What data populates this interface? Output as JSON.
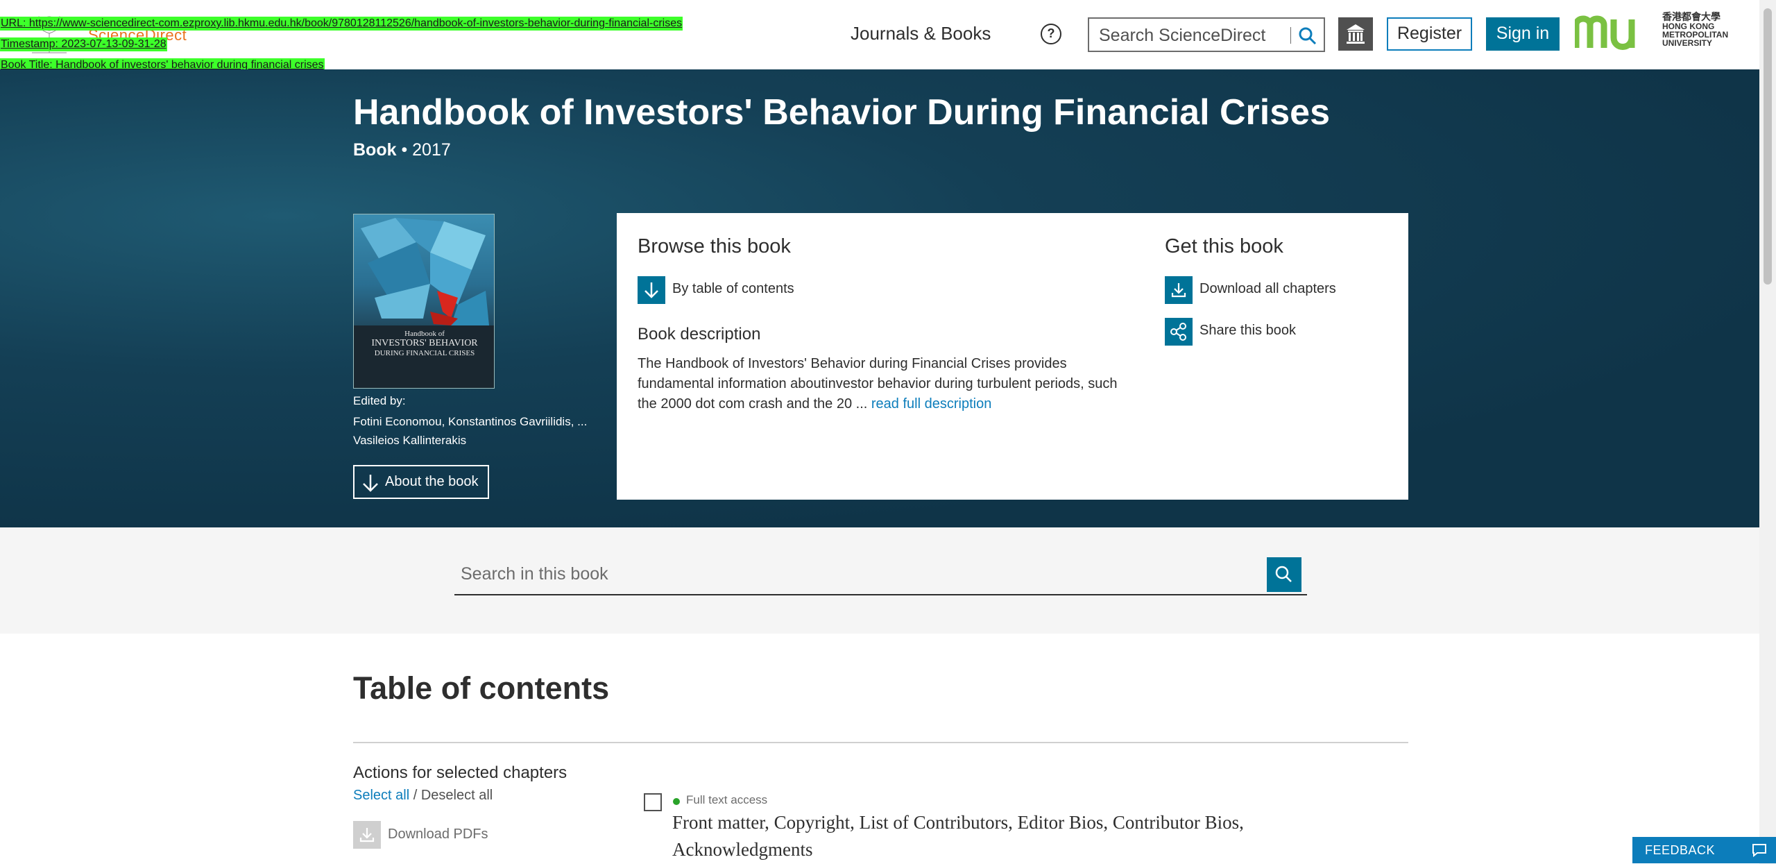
{
  "overlay": {
    "url": "URL: https://www-sciencedirect-com.ezproxy.lib.hkmu.edu.hk/book/9780128112526/handbook-of-investors-behavior-during-financial-crises",
    "timestamp": "Timestamp: 2023-07-13-09-31-28",
    "book_title": "Book Title: Handbook of investors' behavior during financial crises"
  },
  "header": {
    "logo_text": "ScienceDirect",
    "nav_journals": "Journals & Books",
    "help_symbol": "?",
    "search_placeholder": "Search ScienceDirect",
    "register_label": "Register",
    "signin_label": "Sign in",
    "university_name": [
      "香港都會大學",
      "HONG KONG",
      "METROPOLITAN",
      "UNIVERSITY"
    ]
  },
  "book": {
    "title": "Handbook of Investors' Behavior During Financial Crises",
    "type": "Book",
    "year": "• 2017",
    "edited_by_label": "Edited by:",
    "editors": "Fotini Economou, Konstantinos Gavriilidis, ... Vasileios Kallinterakis",
    "about_label": "About the book",
    "cover_title_lines": [
      "Handbook of",
      "INVESTORS' BEHAVIOR",
      "DURING FINANCIAL CRISES"
    ]
  },
  "panel": {
    "browse_title": "Browse this book",
    "toc_link": "By table of contents",
    "get_title": "Get this book",
    "download_all": "Download all chapters",
    "share": "Share this book",
    "desc_title": "Book description",
    "desc_text": "The Handbook of Investors' Behavior during Financial Crises provides fundamental information aboutinvestor behavior during turbulent periods, such the 2000 dot com crash and the 20 ...",
    "read_more": "read full description"
  },
  "book_search": {
    "placeholder": "Search in this book"
  },
  "toc": {
    "title": "Table of contents",
    "actions_title": "Actions for selected chapters",
    "select_all": "Select all",
    "separator": " / ",
    "deselect_all": "Deselect all",
    "download_pdfs": "Download PDFs",
    "chapters": [
      {
        "access": "Full text access",
        "title": "Front matter, Copyright, List of Contributors, Editor Bios, Contributor Bios, Acknowledgments"
      }
    ]
  },
  "feedback_label": "FEEDBACK",
  "colors": {
    "brand_teal": "#007398",
    "link_blue": "#0c7dbb",
    "hero_bg": "#143f55",
    "elsevier_orange": "#e9711c",
    "hkmu_green": "#7ac142",
    "access_green": "#29a329"
  }
}
